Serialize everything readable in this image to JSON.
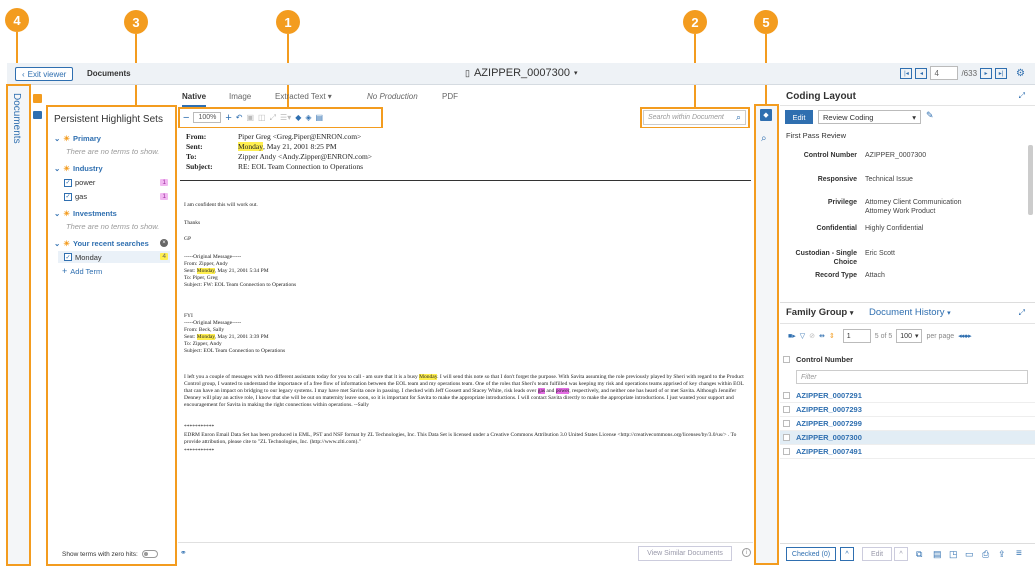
{
  "badges": [
    "4",
    "3",
    "1",
    "2",
    "5"
  ],
  "topbar": {
    "exit_label": "Exit viewer",
    "documents_label": "Documents",
    "doc_title": "AZIPPER_0007300",
    "page_value": "4",
    "page_total": "/633"
  },
  "leftstrip": {
    "label": "Documents"
  },
  "highlight": {
    "title": "Persistent Highlight Sets",
    "primary": "Primary",
    "primary_empty": "There are no terms to show.",
    "industry": "Industry",
    "term_power": "power",
    "count_power": "1",
    "term_gas": "gas",
    "count_gas": "1",
    "investments": "Investments",
    "investments_empty": "There are no terms to show.",
    "recent": "Your recent searches",
    "term_monday": "Monday",
    "count_monday": "4",
    "add_term": "Add Term",
    "zero_hits": "Show terms with zero hits:"
  },
  "tabs": [
    "Native",
    "Image",
    "Extracted Text",
    "No Production",
    "PDF"
  ],
  "toolbar": {
    "zoom": "100%"
  },
  "search_doc_placeholder": "Search within Document",
  "email": {
    "from_l": "From:",
    "from_v": "Piper Greg <Greg.Piper@ENRON.com>",
    "sent_l": "Sent:",
    "sent_hl": "Monday",
    "sent_v": ", May 21, 2001 8:25 PM",
    "to_l": "To:",
    "to_v": "Zipper Andy <Andy.Zipper@ENRON.com>",
    "subj_l": "Subject:",
    "subj_v": "RE: EOL Team Connection to Operations",
    "line1": "I am confident this will work out.",
    "line2": "Thanks",
    "line3": "GP",
    "orig1": "-----Original Message-----",
    "orig1_from": "From:   Zipper, Andy",
    "orig1_sent_a": "Sent:   ",
    "orig1_sent_hl": "Monday",
    "orig1_sent_b": ", May 21, 2001 5:34 PM",
    "orig1_to": "To:    Piper, Greg",
    "orig1_subj": "Subject:     FW: EOL Team Connection to Operations",
    "fyi": "FYI",
    "orig2": " -----Original Message-----",
    "orig2_from": "From:   Beck, Sally",
    "orig2_sent_a": "Sent:   ",
    "orig2_sent_hl": "Monday",
    "orig2_sent_b": ", May 21, 2001 3:39 PM",
    "orig2_to": "To:   Zipper, Andy",
    "orig2_subj": "Subject:       EOL Team Connection to Operations",
    "para_a": "I left you a couple of messages with two different assistants today for you to call - am sure that it is a busy ",
    "para_hl": "Monday",
    "para_b": ".  I will send this note so that I don't forget the purpose.  With Savita assuming the role previously played by Sheri with regard to the Product Control group, I wanted to understand the importance of a free flow of information between the EOL team and my operations team.  One of the roles that Sheri's team fulfilled was keeping my risk and operations teams apprised of key changes within EOL that can have an impact on bridging to our legacy systems.  I may have met Savita once in passing.  I checked with Jeff Gossett and Stacey White, risk leads over ",
    "para_gas": "gas",
    "para_c": " and ",
    "para_power": "power",
    "para_d": ", respectively, and neither one has heard of or met Savita.  Although Jennifer Denney will play an active role, I know that she will be out on maternity leave soon, so it is important for Savita to make the appropriate introductions.  I will contact Savita directly to make the appropriate introductions.  I just wanted your support and encouragement for Savita in making the right connections within operations.   --Sally",
    "stars1": "***********",
    "edrm": "EDRM Enron Email Data Set has been produced in EML, PST and NSF format by ZL Technologies, Inc. This Data Set is licensed under a Creative Commons Attribution 3.0 United States License <http://creativecommons.org/licenses/by/3.0/us/> . To provide attribution, please cite to \"ZL Technologies, Inc. (http://www.zlti.com).\"",
    "stars2": "***********"
  },
  "view_similar": "View Similar Documents",
  "coding": {
    "title": "Coding Layout",
    "edit": "Edit",
    "layout": "Review Coding",
    "section": "First Pass Review",
    "fields": [
      {
        "label": "Control Number",
        "value": "AZIPPER_0007300"
      },
      {
        "label": "Responsive",
        "value": "Technical Issue"
      },
      {
        "label": "Privilege",
        "value": "Attorney Client Communication"
      },
      {
        "label": "",
        "value": "Attorney Work Product"
      },
      {
        "label": "Confidential",
        "value": "Highly Confidential"
      },
      {
        "label": "Custodian - Single",
        "value": "Eric Scott"
      },
      {
        "label": "Choice",
        "value": ""
      },
      {
        "label": "Record Type",
        "value": "Attach"
      }
    ]
  },
  "family": {
    "tab1": "Family Group",
    "tab2": "Document History",
    "page_in": "1",
    "page_of": "5 of 5",
    "per_page": "100",
    "per_page_label": "per page",
    "col": "Control Number",
    "filter": "Filter",
    "rows": [
      "AZIPPER_0007291",
      "AZIPPER_0007293",
      "AZIPPER_0007299",
      "AZIPPER_0007300",
      "AZIPPER_0007491"
    ]
  },
  "bottom": {
    "checked": "Checked (0)",
    "edit": "Edit"
  },
  "colors": {
    "accent": "#f39c1f",
    "blue": "#2f6fb0",
    "highlight_yellow": "#ffef4f",
    "highlight_magenta": "#e56ee5"
  }
}
